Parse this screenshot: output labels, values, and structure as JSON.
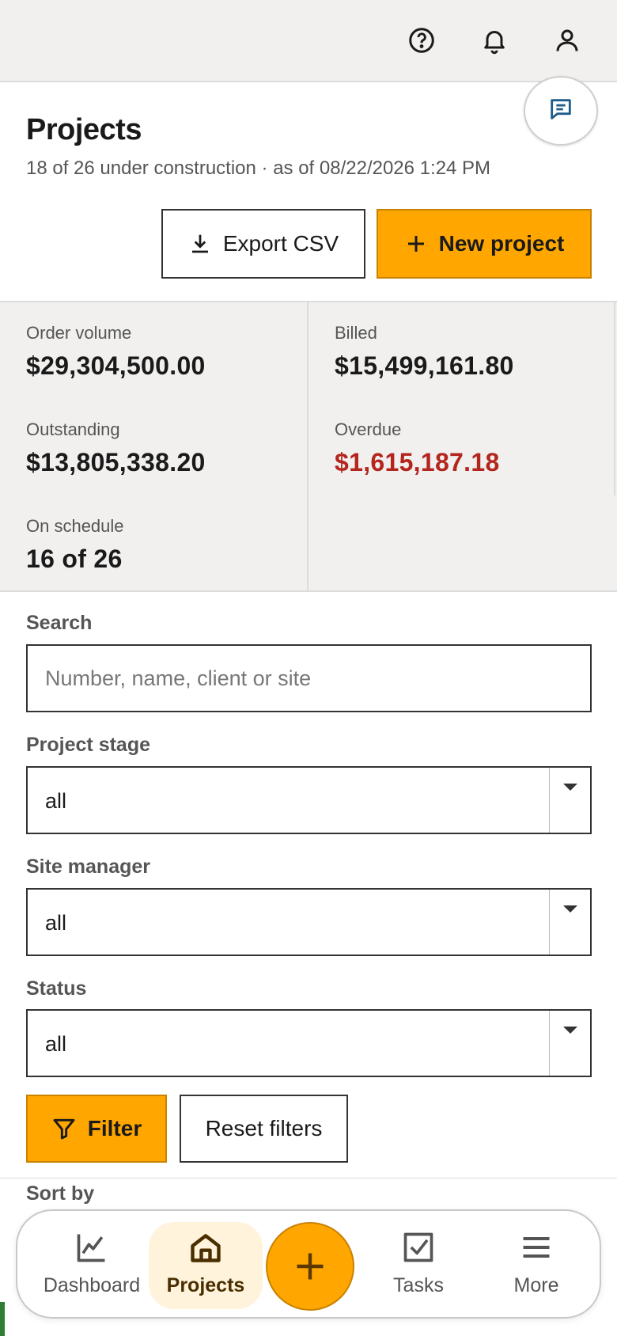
{
  "header": {
    "icons": [
      "help-icon",
      "bell-icon",
      "user-icon"
    ]
  },
  "chat": {
    "icon": "chat-icon"
  },
  "page": {
    "title": "Projects",
    "subtitle": "18 of 26 under construction · as of 08/22/2026 1:24 PM"
  },
  "actions": {
    "export_label": "Export CSV",
    "new_label": "New project"
  },
  "stats": {
    "order_volume": {
      "label": "Order volume",
      "value": "$29,304,500.00"
    },
    "billed": {
      "label": "Billed",
      "value": "$15,499,161.80"
    },
    "outstanding": {
      "label": "Outstanding",
      "value": "$13,805,338.20"
    },
    "overdue": {
      "label": "Overdue",
      "value": "$1,615,187.18",
      "color": "#b3261e"
    },
    "on_schedule": {
      "label": "On schedule",
      "value": "16 of 26"
    }
  },
  "filters": {
    "search": {
      "label": "Search",
      "placeholder": "Number, name, client or site",
      "value": ""
    },
    "stage": {
      "label": "Project stage",
      "value": "all"
    },
    "manager": {
      "label": "Site manager",
      "value": "all"
    },
    "status": {
      "label": "Status",
      "value": "all"
    },
    "filter_label": "Filter",
    "reset_label": "Reset filters"
  },
  "sort": {
    "label": "Sort by"
  },
  "nav": {
    "items": [
      {
        "label": "Dashboard",
        "icon": "chart-icon",
        "active": false
      },
      {
        "label": "Projects",
        "icon": "home-icon",
        "active": true
      },
      {
        "label": "Tasks",
        "icon": "checkbox-icon",
        "active": false
      },
      {
        "label": "More",
        "icon": "menu-icon",
        "active": false
      }
    ],
    "fab_icon": "plus-icon"
  },
  "colors": {
    "accent": "#ffa600",
    "danger": "#b3261e",
    "surface": "#f1f0ef"
  }
}
